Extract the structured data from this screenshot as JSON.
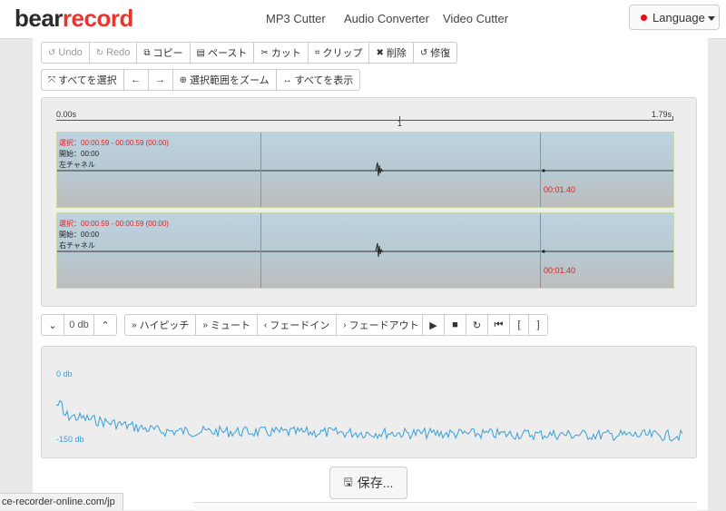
{
  "brand": {
    "part1": "bear",
    "part2": "record",
    "color_dark": "#2b2b2b",
    "color_red": "#e8352e"
  },
  "nav": {
    "links": [
      "MP3 Cutter",
      "Audio Converter",
      "Video Cutter"
    ],
    "language_label": "Language"
  },
  "toolbar1": {
    "undo": "Undo",
    "redo": "Redo",
    "copy": "コピー",
    "paste": "ペースト",
    "cut": "カット",
    "clip": "クリップ",
    "delete": "削除",
    "restore": "修復"
  },
  "toolbar2": {
    "select_all": "すべてを選択",
    "left_arrow": "←",
    "right_arrow": "→",
    "zoom_selection": "選択範囲をズーム",
    "show_all": "すべてを表示"
  },
  "timeline": {
    "start": "0.00s",
    "mid": "1",
    "end": "1.79s"
  },
  "channels": [
    {
      "selection": "選択：00:00.59 - 00:00.59 (00:00)",
      "start": "開始：00:00",
      "name": "左チャネル",
      "end_time": "00:01.40"
    },
    {
      "selection": "選択：00:00.59 - 00:00.59 (00:00)",
      "start": "開始：00:00",
      "name": "右チャネル",
      "end_time": "00:01.40"
    }
  ],
  "volume": {
    "down": "⌄",
    "value": "0 db",
    "up": "⌃"
  },
  "effects": {
    "high_pitch": "ハイピッチ",
    "mute": "ミュート",
    "fade_in": "フェードイン",
    "fade_out": "フェードアウト"
  },
  "transport": {
    "play": "▶",
    "stop": "■",
    "repeat": "↻",
    "to_start": "⏮",
    "mark_in": "[",
    "mark_out": "]"
  },
  "spectrum": {
    "top_label": "0 db",
    "bottom_label": "-150 db",
    "line_color": "#3a9fd6"
  },
  "save": {
    "label": "保存..."
  },
  "status": {
    "url": "ce-recorder-online.com/jp"
  }
}
